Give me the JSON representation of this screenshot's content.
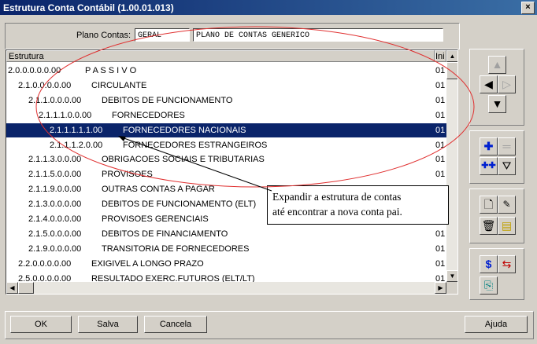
{
  "window": {
    "title": "Estrutura Conta Contábil (1.00.01.013)",
    "close": "×"
  },
  "plano": {
    "label": "Plano Contas:",
    "code": "GERAL",
    "desc": "PLANO DE CONTAS GENERICO"
  },
  "tree": {
    "header": {
      "col1": "Estrutura",
      "col2": "Ini"
    },
    "rows": [
      {
        "code": "2.0.0.0.0.0.00",
        "name": "P A S S I V O",
        "ini": "01"
      },
      {
        "code": "2.1.0.0.0.0.00",
        "name": "CIRCULANTE",
        "ini": "01"
      },
      {
        "code": "2.1.1.0.0.0.00",
        "name": "DEBITOS DE FUNCIONAMENTO",
        "ini": "01"
      },
      {
        "code": "2.1.1.1.0.0.00",
        "name": "FORNECEDORES",
        "ini": "01"
      },
      {
        "code": "2.1.1.1.1.1.00",
        "name": "FORNECEDORES NACIONAIS",
        "ini": "01"
      },
      {
        "code": "2.1.1.1.2.0.00",
        "name": "FORNECEDORES ESTRANGEIROS",
        "ini": "01"
      },
      {
        "code": "2.1.1.3.0.0.00",
        "name": "OBRIGACOES SOCIAIS E TRIBUTARIAS",
        "ini": "01"
      },
      {
        "code": "2.1.1.5.0.0.00",
        "name": "PROVISOES",
        "ini": "01"
      },
      {
        "code": "2.1.1.9.0.0.00",
        "name": "OUTRAS CONTAS A PAGAR",
        "ini": "01"
      },
      {
        "code": "2.1.3.0.0.0.00",
        "name": "DEBITOS DE FUNCIONAMENTO (ELT)",
        "ini": "01"
      },
      {
        "code": "2.1.4.0.0.0.00",
        "name": "PROVISOES GERENCIAIS",
        "ini": "01"
      },
      {
        "code": "2.1.5.0.0.0.00",
        "name": "DEBITOS DE FINANCIAMENTO",
        "ini": "01"
      },
      {
        "code": "2.1.9.0.0.0.00",
        "name": "TRANSITORIA DE FORNECEDORES",
        "ini": "01"
      },
      {
        "code": "2.2.0.0.0.0.00",
        "name": "EXIGIVEL A LONGO PRAZO",
        "ini": "01"
      },
      {
        "code": "2.5.0.0.0.0.00",
        "name": "RESULTADO EXERC.FUTUROS (ELT/LT)",
        "ini": "01"
      }
    ]
  },
  "callout": {
    "line1": "Expandir a estrutura de contas",
    "line2": "até encontrar a nova conta pai."
  },
  "buttons": {
    "ok": "OK",
    "salva": "Salva",
    "cancela": "Cancela",
    "ajuda": "Ajuda"
  },
  "icons": {
    "dollar": "$"
  }
}
